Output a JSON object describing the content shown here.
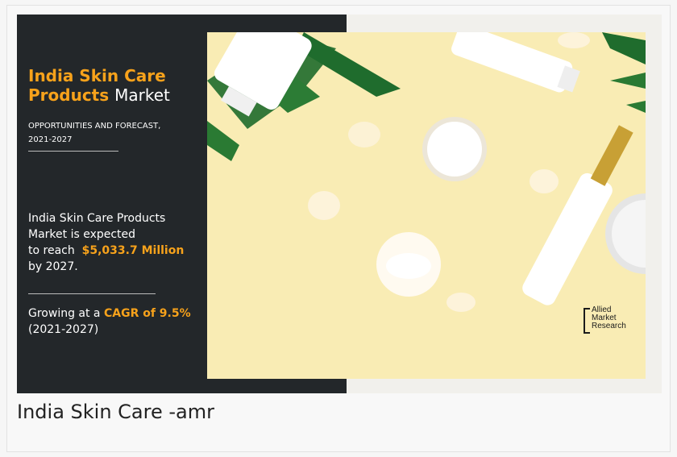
{
  "banner": {
    "title_highlight_1": "India Skin Care",
    "title_highlight_2": "Products",
    "title_rest": "Market",
    "subtitle_line1": "OPPORTUNITIES AND FORECAST,",
    "subtitle_line2": "2021-2027",
    "body_line1": "India Skin Care Products",
    "body_line2": "Market is expected",
    "body_line3_prefix": "to reach",
    "body_value": "$5,033.7 Million",
    "body_line4": "by 2027.",
    "growing_prefix": "Growing at a",
    "growing_value": "CAGR of 9.5%",
    "growing_period": "(2021-2027)",
    "brand_colors": {
      "accent": "#f7a21b",
      "panel": "#23272a",
      "photo_bg": "#f9ecb4"
    }
  },
  "logo": {
    "line1": "Allied",
    "line2": "Market",
    "line3": "Research"
  },
  "caption": "India Skin Care -amr"
}
